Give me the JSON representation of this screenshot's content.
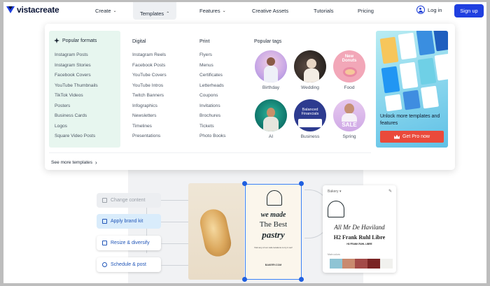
{
  "header": {
    "logo": "vistacreate",
    "nav": [
      {
        "label": "Create",
        "chevron": "chevron-down-icon"
      },
      {
        "label": "Templates",
        "chevron": "chevron-up-icon",
        "active": true
      },
      {
        "label": "Features",
        "chevron": "chevron-down-icon"
      },
      {
        "label": "Creative Assets"
      },
      {
        "label": "Tutorials"
      },
      {
        "label": "Pricing"
      }
    ],
    "login": "Log in",
    "signup": "Sign up"
  },
  "menu": {
    "popular_formats": {
      "title": "Popular formats",
      "items": [
        "Instagram Posts",
        "Instagram Stories",
        "Facebook Covers",
        "YouTube Thumbnails",
        "TikTok Videos",
        "Posters",
        "Business Cards",
        "Logos",
        "Square Video Posts"
      ]
    },
    "digital": {
      "title": "Digital",
      "items": [
        "Instagram Reels",
        "Facebook Posts",
        "YouTube Covers",
        "YouTube Intros",
        "Twitch Banners",
        "Infographics",
        "Newsletters",
        "Timelines",
        "Presentations"
      ]
    },
    "print": {
      "title": "Print",
      "items": [
        "Flyers",
        "Menus",
        "Certificates",
        "Letterheads",
        "Coupons",
        "Invitations",
        "Brochures",
        "Tickets",
        "Photo Books"
      ]
    },
    "tags": {
      "title": "Popular tags",
      "items": [
        {
          "label": "Birthday",
          "circle_text": ""
        },
        {
          "label": "Wedding",
          "circle_text": ""
        },
        {
          "label": "Food",
          "circle_text": "New Donuts"
        },
        {
          "label": "AI",
          "circle_text": ""
        },
        {
          "label": "Business",
          "circle_text": "Balanced Financials"
        },
        {
          "label": "Spring",
          "circle_text": "SALE"
        }
      ]
    },
    "see_more": "See more templates",
    "promo": {
      "text": "Unlock more templates and features",
      "button": "Get Pro now"
    }
  },
  "demo": {
    "steps": [
      "Change content",
      "Apply brand kit",
      "Resize & diversify",
      "Schedule & post"
    ],
    "poster": {
      "line1": "we made",
      "line2": "The Best",
      "line3": "pastry",
      "small": "Visit any of our cafe locations to try it out!",
      "url": "BAKERY.COM"
    },
    "brand_card": {
      "name": "Bakery",
      "script_font": "All Mr De Haviland",
      "slab_font": "H2 Frank Ruhl Libre",
      "small_font": "H3 FRANK RUHL LIBRE",
      "memories_label": "Main colors",
      "swatches": [
        "#8fc4d4",
        "#c98a6f",
        "#a34a48",
        "#7a2424",
        "#f1f1ee"
      ]
    }
  },
  "colors": {
    "brand_blue": "#1f3fe0",
    "pro_red": "#ea4a3b",
    "popular_bg": "#e7f6ef"
  }
}
